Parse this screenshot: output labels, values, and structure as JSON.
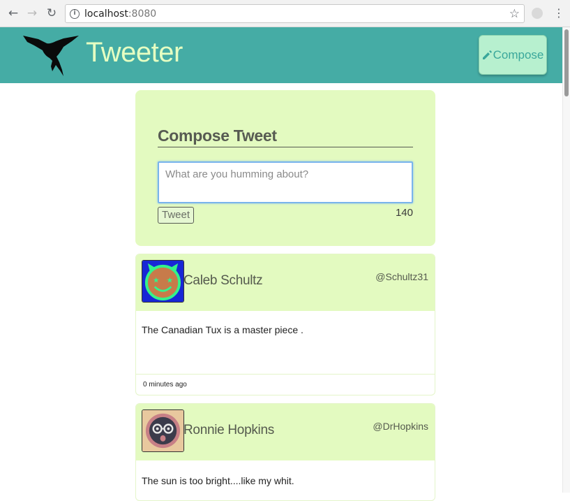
{
  "browser": {
    "url_host": "localhost",
    "url_port": ":8080"
  },
  "header": {
    "title": "Tweeter",
    "compose_label": "Compose"
  },
  "compose": {
    "heading": "Compose Tweet",
    "placeholder": "What are you humming about?",
    "submit_label": "Tweet",
    "char_count": "140"
  },
  "tweets": [
    {
      "name": "Caleb Schultz",
      "handle": "@Schultz31",
      "content": "The Canadian Tux is a master piece .",
      "timestamp": "0 minutes ago",
      "avatar_colors": {
        "bg": "#1826d6",
        "face": "#c77b4a",
        "accent": "#34f28a"
      }
    },
    {
      "name": "Ronnie Hopkins",
      "handle": "@DrHopkins",
      "content": "The sun is too bright....like my whit.",
      "avatar_colors": {
        "bg": "#e8c89e",
        "face": "#c77f86",
        "accent": "#3b3b4b"
      }
    }
  ],
  "colors": {
    "header_bg": "#45aca5",
    "title": "#e6ffc2",
    "card_bg": "#e3fac0"
  }
}
